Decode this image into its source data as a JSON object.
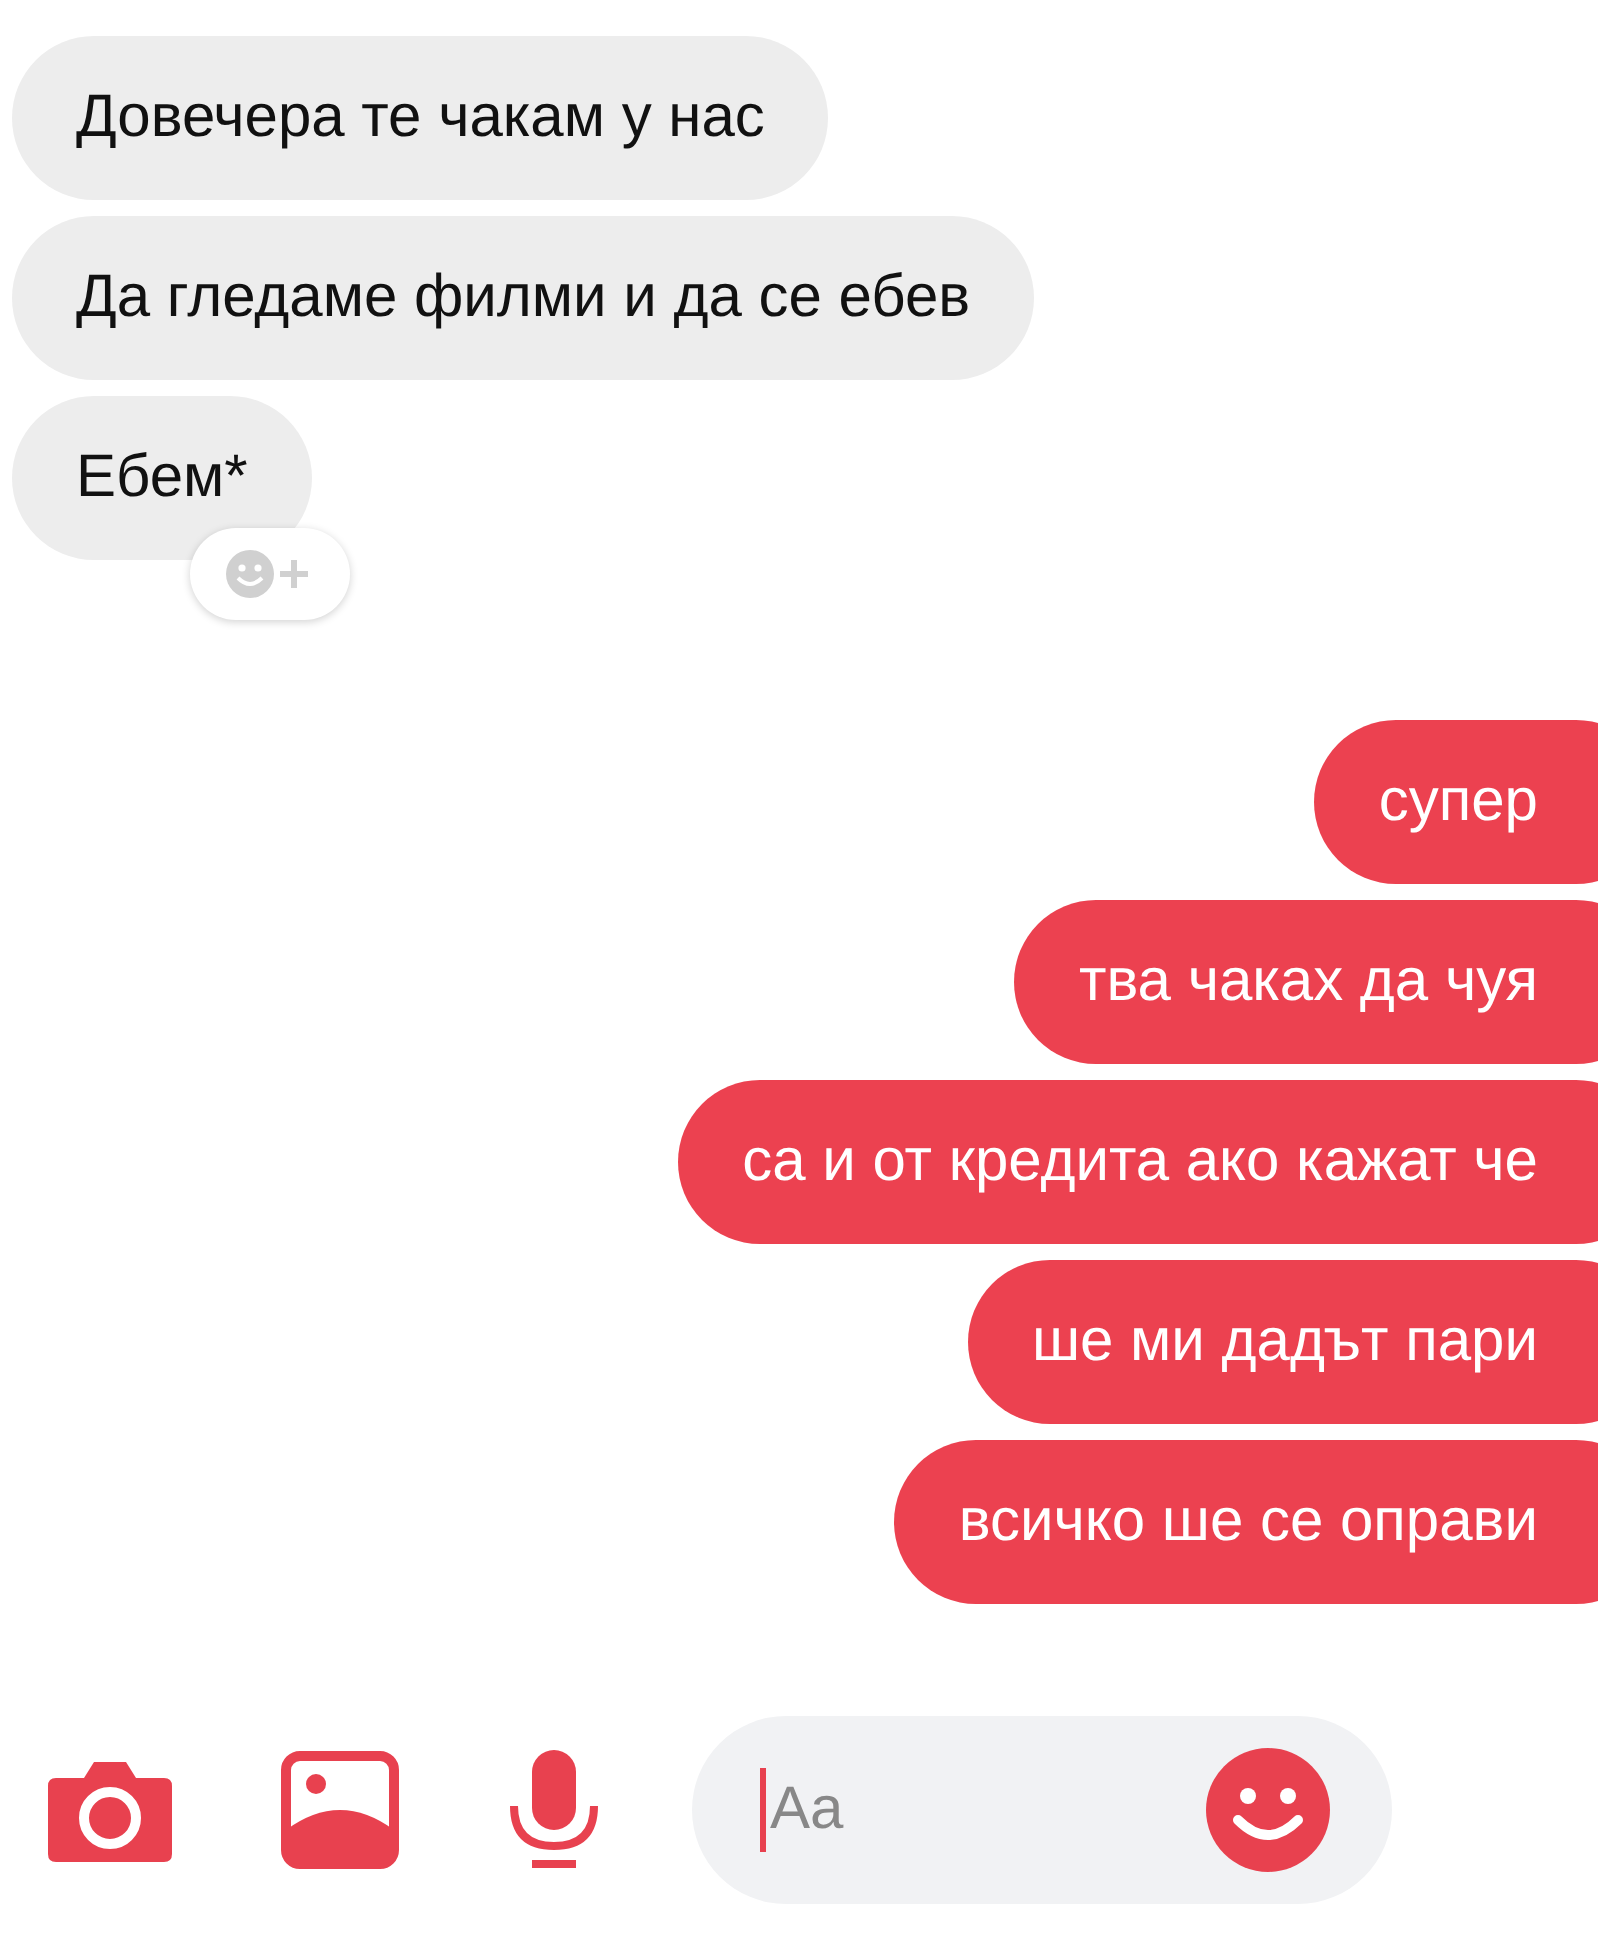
{
  "messages": [
    {
      "kind": "incoming",
      "text": "Довечера те чакам у нас",
      "reaction_button": false
    },
    {
      "kind": "incoming",
      "text": "Да гледаме филми и да се ебев",
      "reaction_button": false
    },
    {
      "kind": "incoming",
      "text": "Ебем*",
      "reaction_button": true
    },
    {
      "kind": "outgoing",
      "text": "супер",
      "reaction_button": false
    },
    {
      "kind": "outgoing",
      "text": "тва чаках да чуя",
      "reaction_button": false
    },
    {
      "kind": "outgoing",
      "text": "са и от кредита ако кажат че",
      "reaction_button": false
    },
    {
      "kind": "outgoing",
      "text": "ше ми дадът пари",
      "reaction_button": false
    },
    {
      "kind": "outgoing",
      "text": "всичко ше се оправи",
      "reaction_button": false
    }
  ],
  "composer": {
    "placeholder": "Aa"
  }
}
